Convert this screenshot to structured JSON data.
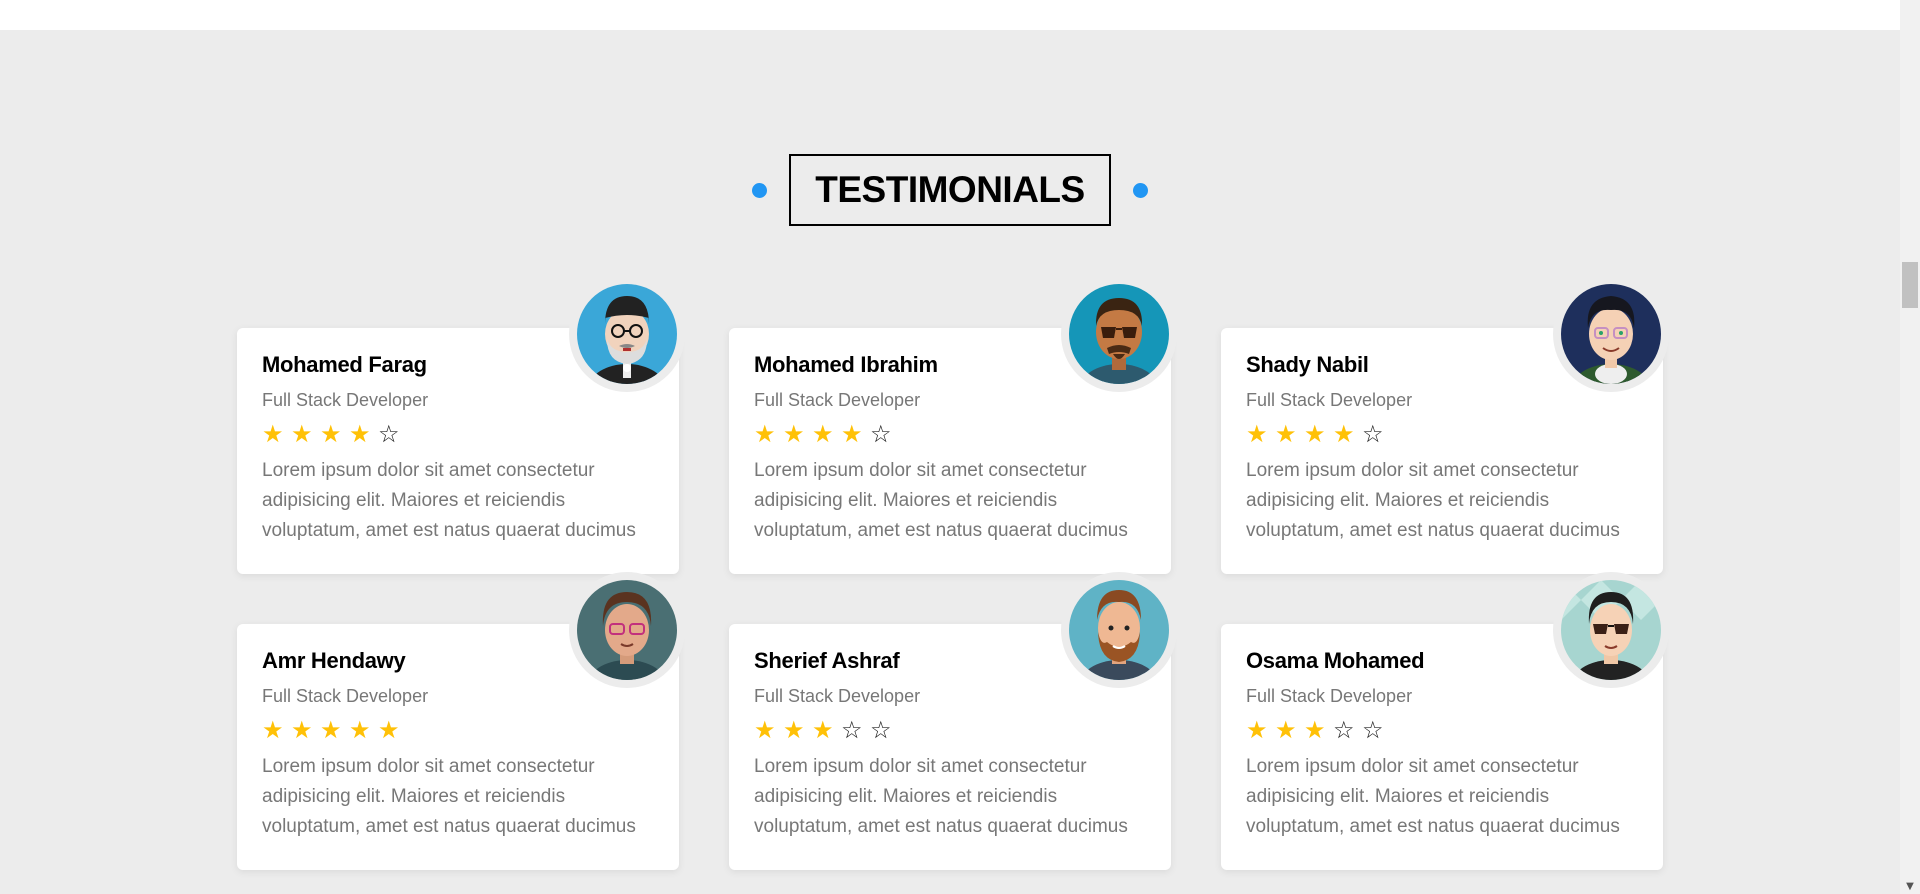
{
  "section": {
    "title": "TESTIMONIALS"
  },
  "colors": {
    "accent": "#2196f3",
    "star": "#ffc107"
  },
  "testimonials": [
    {
      "name": "Mohamed Farag",
      "role": "Full Stack Developer",
      "rating": 4,
      "text": "Lorem ipsum dolor sit amet consectetur adipisicing elit. Maiores et reiciendis voluptatum, amet est natus quaerat ducimus",
      "avatar_icon": "avatar-icon"
    },
    {
      "name": "Mohamed Ibrahim",
      "role": "Full Stack Developer",
      "rating": 4,
      "text": "Lorem ipsum dolor sit amet consectetur adipisicing elit. Maiores et reiciendis voluptatum, amet est natus quaerat ducimus",
      "avatar_icon": "avatar-icon"
    },
    {
      "name": "Shady Nabil",
      "role": "Full Stack Developer",
      "rating": 4,
      "text": "Lorem ipsum dolor sit amet consectetur adipisicing elit. Maiores et reiciendis voluptatum, amet est natus quaerat ducimus",
      "avatar_icon": "avatar-icon"
    },
    {
      "name": "Amr Hendawy",
      "role": "Full Stack Developer",
      "rating": 5,
      "text": "Lorem ipsum dolor sit amet consectetur adipisicing elit. Maiores et reiciendis voluptatum, amet est natus quaerat ducimus",
      "avatar_icon": "avatar-icon"
    },
    {
      "name": "Sherief Ashraf",
      "role": "Full Stack Developer",
      "rating": 3,
      "text": "Lorem ipsum dolor sit amet consectetur adipisicing elit. Maiores et reiciendis voluptatum, amet est natus quaerat ducimus",
      "avatar_icon": "avatar-icon"
    },
    {
      "name": "Osama Mohamed",
      "role": "Full Stack Developer",
      "rating": 3,
      "text": "Lorem ipsum dolor sit amet consectetur adipisicing elit. Maiores et reiciendis voluptatum, amet est natus quaerat ducimus",
      "avatar_icon": "avatar-icon"
    }
  ]
}
